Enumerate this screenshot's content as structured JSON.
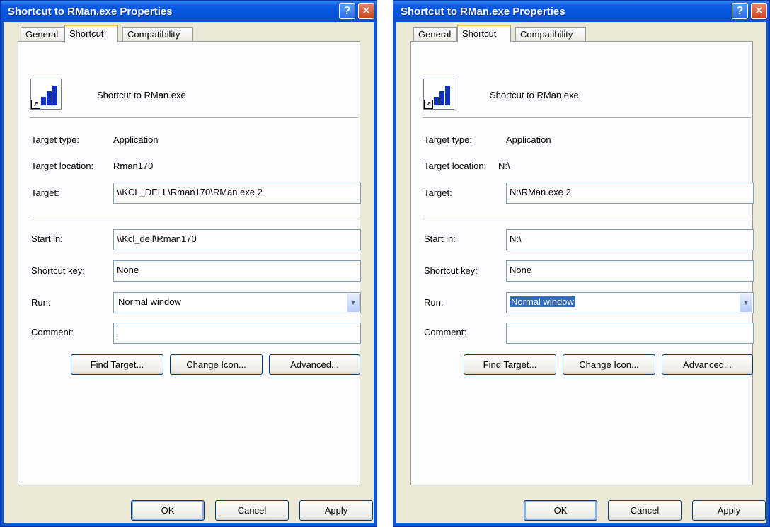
{
  "dialog_title": "Shortcut to RMan.exe Properties",
  "tabs": [
    "General",
    "Shortcut",
    "Compatibility"
  ],
  "header_name": "Shortcut to RMan.exe",
  "labels": {
    "target_type": "Target type:",
    "target_location": "Target location:",
    "target": "Target:",
    "start_in": "Start in:",
    "shortcut_key": "Shortcut key:",
    "run": "Run:",
    "comment": "Comment:"
  },
  "buttons": {
    "find_target": "Find Target...",
    "change_icon": "Change Icon...",
    "advanced": "Advanced...",
    "ok": "OK",
    "cancel": "Cancel",
    "apply": "Apply"
  },
  "dialogs": [
    {
      "target_type": "Application",
      "target_location": "Rman170",
      "target": "\\\\KCL_DELL\\Rman170\\RMan.exe 2",
      "start_in": "\\\\Kcl_dell\\Rman170",
      "shortcut_key": "None",
      "run": "Normal window",
      "comment": ""
    },
    {
      "target_type": "Application",
      "target_location": "N:\\",
      "target": "N:\\RMan.exe 2",
      "start_in": "N:\\",
      "shortcut_key": "None",
      "run": "Normal window",
      "comment": ""
    }
  ],
  "icons": {
    "help": "help-icon",
    "close": "close-icon",
    "app": "signal-bars-app-icon",
    "dropdown": "chevron-down-icon"
  },
  "colors": {
    "titlebar": "#0a56d8",
    "dialog_face": "#ece9d8",
    "selection": "#316ac5"
  }
}
